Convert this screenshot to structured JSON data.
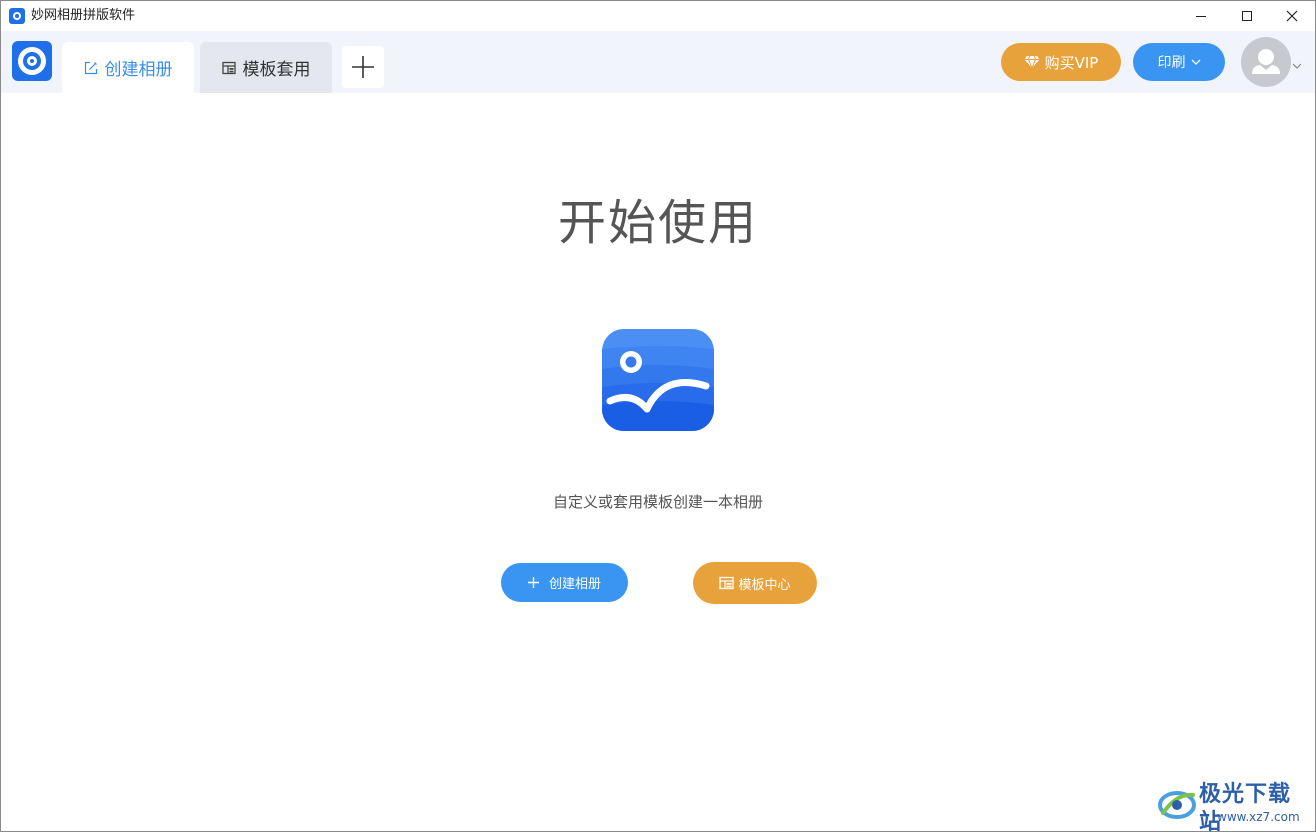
{
  "window": {
    "title": "妙网相册拼版软件"
  },
  "tabs": [
    {
      "label": "创建相册",
      "icon": "edit-icon",
      "active": true
    },
    {
      "label": "模板套用",
      "icon": "layout-icon",
      "active": false
    }
  ],
  "header": {
    "vip_label": "购买VIP",
    "print_label": "印刷"
  },
  "main": {
    "title": "开始使用",
    "subtitle": "自定义或套用模板创建一本相册",
    "create_button": "创建相册",
    "template_button": "模板中心"
  },
  "watermark": {
    "text": "极光下载站",
    "url": "www.xz7.com"
  },
  "colors": {
    "brand_blue": "#1e6fe8",
    "accent_blue": "#3a95f2",
    "accent_orange": "#e8a23c",
    "header_bg": "#f1f5fb"
  }
}
